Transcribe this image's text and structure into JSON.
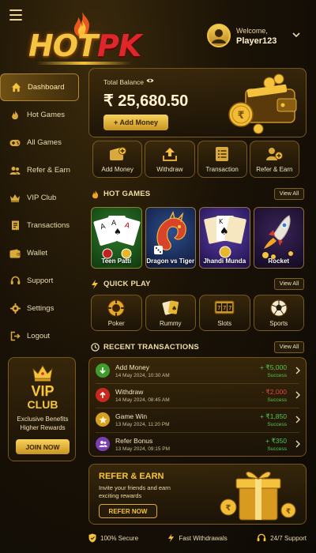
{
  "header": {
    "logo_hot": "HOT",
    "logo_pk": "PK",
    "welcome": "Welcome,",
    "username": "Player123"
  },
  "sidebar": {
    "items": [
      {
        "label": "Dashboard",
        "icon": "home-icon",
        "active": true
      },
      {
        "label": "Hot Games",
        "icon": "flame-icon"
      },
      {
        "label": "All Games",
        "icon": "gamepad-icon"
      },
      {
        "label": "Refer & Earn",
        "icon": "users-icon"
      },
      {
        "label": "VIP Club",
        "icon": "crown-icon"
      },
      {
        "label": "Transactions",
        "icon": "receipt-icon"
      },
      {
        "label": "Wallet",
        "icon": "wallet-icon"
      },
      {
        "label": "Support",
        "icon": "headset-icon"
      },
      {
        "label": "Settings",
        "icon": "gear-icon"
      },
      {
        "label": "Logout",
        "icon": "logout-icon"
      }
    ],
    "vip": {
      "title": "VIP",
      "title2": "CLUB",
      "line1": "Exclusive Benefits",
      "line2": "Higher Rewards",
      "button": "JOIN NOW"
    }
  },
  "balance": {
    "label": "Total Balance",
    "amount": "₹ 25,680.50",
    "add_button": "+ Add Money"
  },
  "quick_actions": [
    {
      "label": "Add Money",
      "icon": "wallet-plus-icon"
    },
    {
      "label": "Withdraw",
      "icon": "upload-icon"
    },
    {
      "label": "Transaction",
      "icon": "list-icon"
    },
    {
      "label": "Refer & Earn",
      "icon": "user-plus-icon"
    }
  ],
  "hot_games": {
    "title": "HOT GAMES",
    "view_all": "View All",
    "items": [
      {
        "label": "Teen Patti"
      },
      {
        "label": "Dragon vs Tiger"
      },
      {
        "label": "Jhandi Munda"
      },
      {
        "label": "Rocket"
      }
    ]
  },
  "quick_play": {
    "title": "QUICK PLAY",
    "view_all": "View All",
    "items": [
      {
        "label": "Poker",
        "icon": "poker-chip-icon"
      },
      {
        "label": "Rummy",
        "icon": "cards-icon"
      },
      {
        "label": "Slots",
        "icon": "slot-machine-icon"
      },
      {
        "label": "Sports",
        "icon": "soccer-ball-icon"
      }
    ]
  },
  "transactions": {
    "title": "RECENT TRANSACTIONS",
    "view_all": "View All",
    "rows": [
      {
        "name": "Add Money",
        "date": "14 May 2024, 10:30 AM",
        "amount": "+ ₹5,000",
        "status": "Success",
        "kind": "credit",
        "color": "#3f9d2e"
      },
      {
        "name": "Withdraw",
        "date": "14 May 2024, 08:45 AM",
        "amount": "- ₹2,000",
        "status": "Success",
        "kind": "debit",
        "color": "#c9281f"
      },
      {
        "name": "Game Win",
        "date": "13 May 2024, 11:20 PM",
        "amount": "+ ₹1,850",
        "status": "Success",
        "kind": "credit",
        "color": "#d7a021"
      },
      {
        "name": "Refer Bonus",
        "date": "13 May 2024, 09:15 PM",
        "amount": "+ ₹350",
        "status": "Success",
        "kind": "credit",
        "color": "#7a3fb4"
      }
    ]
  },
  "refer": {
    "title": "REFER & EARN",
    "line1": "Invite your friends and earn",
    "line2": "exciting rewards",
    "button": "REFER NOW"
  },
  "footer": [
    {
      "label": "100% Secure",
      "icon": "shield-icon"
    },
    {
      "label": "Fast Withdrawals",
      "icon": "bolt-icon"
    },
    {
      "label": "24/7 Support",
      "icon": "headset-icon"
    }
  ],
  "colors": {
    "gold": "#f4c23c",
    "credit": "#54c64a",
    "debit": "#e0453a"
  }
}
